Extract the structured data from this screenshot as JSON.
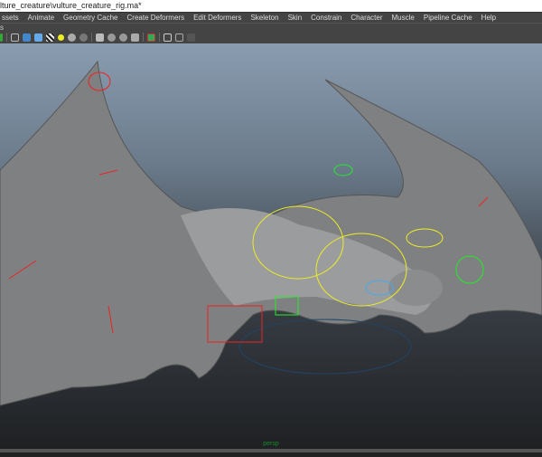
{
  "window": {
    "title": "lture_creature\\vulture_creature_rig.ma*"
  },
  "menu": [
    "ssets",
    "Animate",
    "Geometry Cache",
    "Create Deformers",
    "Edit Deformers",
    "Skeleton",
    "Skin",
    "Constrain",
    "Character",
    "Muscle",
    "Pipeline Cache",
    "Help"
  ],
  "toolbar": {
    "label": "s"
  },
  "viewport": {
    "camera": "persp"
  }
}
